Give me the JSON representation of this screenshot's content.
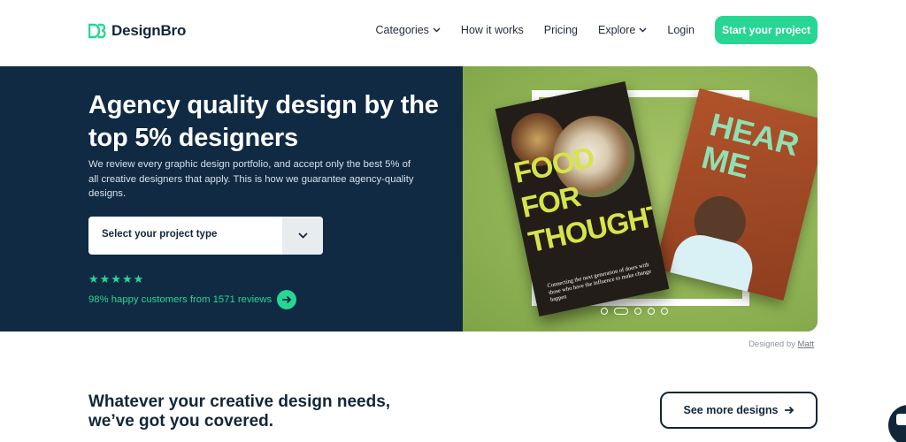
{
  "header": {
    "logo_text": "DesignBro",
    "nav": [
      {
        "label": "Categories",
        "has_dropdown": true
      },
      {
        "label": "How it works",
        "has_dropdown": false
      },
      {
        "label": "Pricing",
        "has_dropdown": false
      },
      {
        "label": "Explore",
        "has_dropdown": true
      },
      {
        "label": "Login",
        "has_dropdown": false
      }
    ],
    "cta_label": "Start your project"
  },
  "hero": {
    "title": "Agency quality design by the top 5% designers",
    "description": "We review every graphic design portfolio, and accept only the best 5% of all creative designers that apply. This is how we guarantee agency-quality designs.",
    "select_placeholder": "Select your project type",
    "stars": "★★★★★",
    "rating": 5,
    "reviews_text": "98% happy customers from 1571 reviews",
    "carousel": {
      "slides": 5,
      "active_index": 1,
      "poster1_words": [
        "FOOD",
        "FOR",
        "THOUGHT"
      ],
      "poster1_small": "Connecting the next generation of doers with those who have the influence to make change happen",
      "poster2_words": [
        "HEAR",
        "ME"
      ]
    },
    "credit_prefix": "Designed by",
    "credit_author": "Matt"
  },
  "section": {
    "title": "Whatever your creative design needs, we’ve got you covered.",
    "button_label": "See more designs"
  },
  "colors": {
    "accent": "#27d693",
    "navy": "#102a43",
    "hero_right_bg": "#90b455"
  },
  "icons": {
    "logo": "db-logo-icon",
    "dropdown": "chevron-down-icon",
    "review_arrow": "arrow-right-circle-icon",
    "button_arrow": "arrow-right-icon",
    "chat": "chat-icon"
  }
}
